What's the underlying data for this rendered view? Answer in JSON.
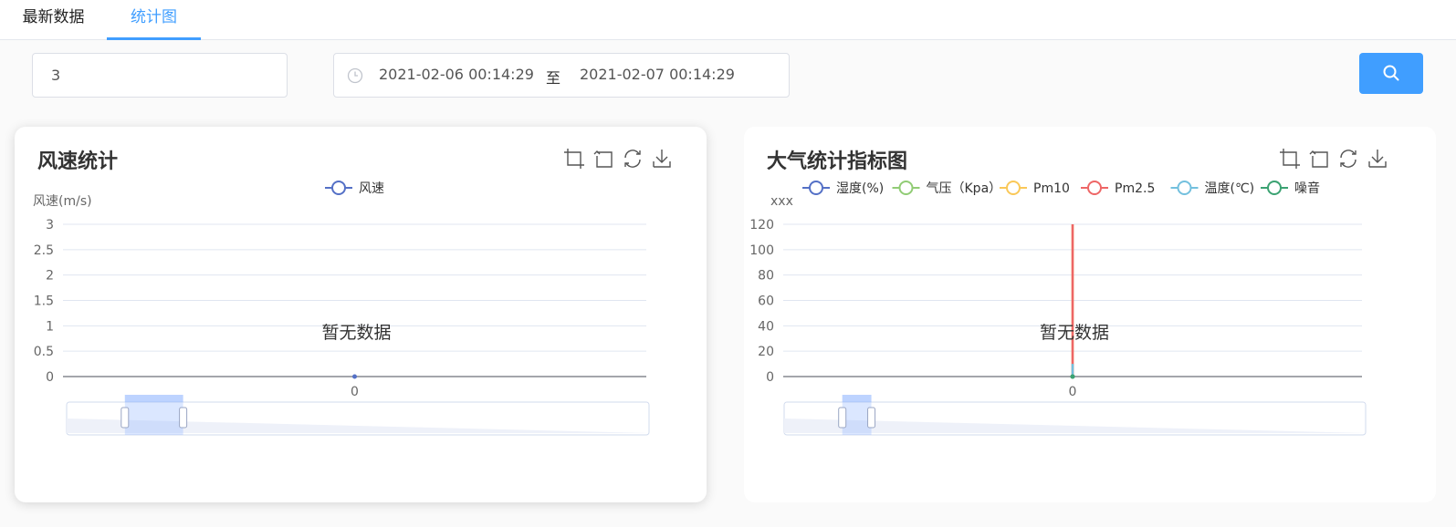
{
  "tabs": [
    {
      "label": "最新数据",
      "active": false
    },
    {
      "label": "统计图",
      "active": true
    }
  ],
  "filters": {
    "count_value": "3",
    "date_start": "2021-02-06 00:14:29",
    "date_separator": "至",
    "date_end": "2021-02-07 00:14:29",
    "search_icon": "search-icon"
  },
  "colors": {
    "accent": "#409eff",
    "humidity": "#5470c6",
    "pressure": "#91cc75",
    "pm10": "#fac858",
    "pm25": "#ee6666",
    "temperature": "#73c0de",
    "noise": "#3ba272"
  },
  "toolbox_icons": [
    "zoom-select-icon",
    "zoom-reset-icon",
    "restore-icon",
    "download-icon"
  ],
  "chart_data": [
    {
      "type": "line",
      "title": "风速统计",
      "ylabel": "风速(m/s)",
      "xlabel": "",
      "categories": [
        "0"
      ],
      "series": [
        {
          "name": "风速",
          "color": "#5470c6",
          "values": [
            0
          ]
        }
      ],
      "ylim": [
        0,
        3
      ],
      "yticks": [
        "0",
        "0.5",
        "1",
        "1.5",
        "2",
        "2.5",
        "3"
      ],
      "empty_text": "暂无数据",
      "legend": "top-center",
      "grid": true,
      "datazoom_range": [
        10,
        20
      ]
    },
    {
      "type": "line",
      "title": "大气统计指标图",
      "ylabel": "xxx",
      "xlabel": "",
      "categories": [
        "0"
      ],
      "series": [
        {
          "name": "湿度(%)",
          "color": "#5470c6",
          "values": [
            0
          ]
        },
        {
          "name": "气压（Kpa）",
          "color": "#91cc75",
          "values": [
            0
          ]
        },
        {
          "name": "Pm10",
          "color": "#fac858",
          "values": [
            120
          ]
        },
        {
          "name": "Pm2.5",
          "color": "#ee6666",
          "values": [
            120
          ]
        },
        {
          "name": "温度(℃)",
          "color": "#73c0de",
          "values": [
            10
          ]
        },
        {
          "name": "噪音",
          "color": "#3ba272",
          "values": [
            0
          ]
        }
      ],
      "ylim": [
        0,
        120
      ],
      "yticks": [
        "0",
        "20",
        "40",
        "60",
        "80",
        "100",
        "120"
      ],
      "empty_text": "暂无数据",
      "legend": "top-center",
      "grid": true,
      "datazoom_range": [
        10,
        15
      ]
    }
  ]
}
